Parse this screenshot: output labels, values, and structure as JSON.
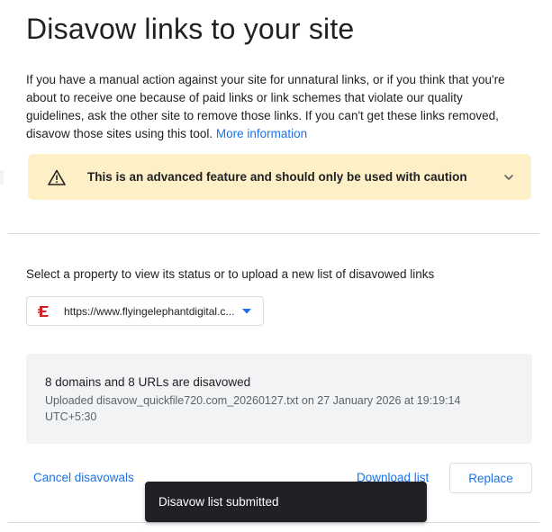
{
  "header": {
    "title": "Disavow links to your site"
  },
  "intro": {
    "text": "If you have a manual action against your site for unnatural links, or if you think that you're about to receive one because of paid links or link schemes that violate our quality guidelines, ask the other site to remove those links. If you can't get these links removed, disavow those sites using this tool.",
    "link_label": "More information"
  },
  "warning": {
    "icon": "warning-triangle-icon",
    "text": "This is an advanced feature and should only be used with caution",
    "expand_icon": "chevron-down-icon",
    "background": "#fdf0c6"
  },
  "property": {
    "label": "Select a property to view its status or to upload a new list of disavowed links",
    "selected": "https://www.flyingelephantdigital.c...",
    "favicon": "flying-elephant-logo",
    "caret_icon": "caret-down-icon",
    "accent": "#1a73e8"
  },
  "status": {
    "summary": "8 domains and 8 URLs are disavowed",
    "detail": "Uploaded disavow_quickfile720.com_20260127.txt on 27 January 2026 at 19:19:14 UTC+5:30"
  },
  "actions": {
    "cancel_label": "Cancel disavowals",
    "download_label": "Download list",
    "replace_label": "Replace"
  },
  "toast": {
    "message": "Disavow list submitted"
  }
}
